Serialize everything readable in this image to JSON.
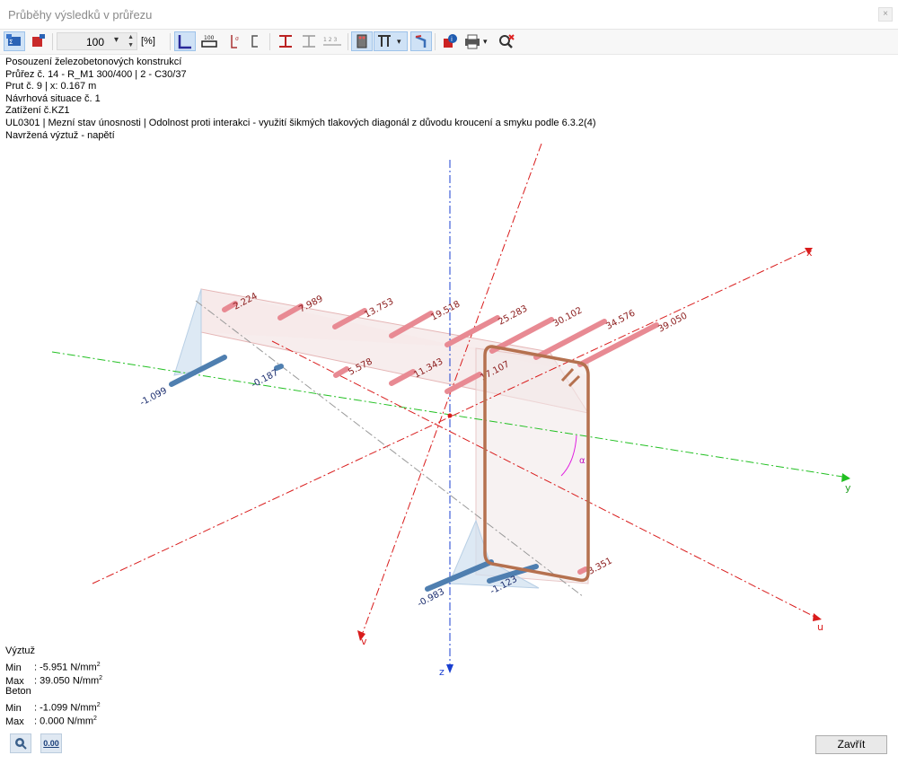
{
  "window": {
    "title": "Průběhy výsledků v průřezu",
    "close_glyph": "×"
  },
  "toolbar": {
    "zoom_value": "100",
    "zoom_unit": "[%]",
    "icons": [
      "section-values-icon",
      "section-values-alt-icon",
      "result-diagram-icon",
      "dimension-icon",
      "stress-icon",
      "section-outline-icon",
      "beam-section-icon",
      "beam-section-outline-icon",
      "numbering-icon",
      "rebar-icon",
      "rebar-dropdown-icon",
      "view-3d-icon",
      "info-icon",
      "print-icon",
      "zoom-reset-icon"
    ]
  },
  "info": {
    "lines": [
      "Posouzení železobetonových konstrukcí",
      "Průřez č. 14 - R_M1 300/400 | 2 - C30/37",
      "Prut č. 9 | x: 0.167 m",
      "Návrhová situace č. 1",
      "Zatížení č.KZ1",
      "UL0301 | Mezní stav únosnosti | Odolnost proti interakci - využití šikmých tlakových diagonál z důvodu kroucení a smyku podle 6.3.2(4)",
      "Navržená výztuž - napětí"
    ]
  },
  "diagram": {
    "axes": {
      "x": "x",
      "y": "y",
      "z": "z",
      "u": "u",
      "v": "v"
    },
    "angle_label": "α",
    "colors": {
      "tension": "#e0737c",
      "compression": "#4f7fb0",
      "stirrup": "#b5714f",
      "axis_red": "#d91c1c",
      "axis_green": "#22c022",
      "axis_blue": "#1a3fd0"
    },
    "tension_bars": [
      "2.224",
      "7.989",
      "13.753",
      "19.518",
      "25.283",
      "30.102",
      "34.576",
      "39.050",
      "5.578",
      "11.343",
      "17.107",
      "3.351"
    ],
    "compression_bars": [
      "-1.099",
      "-0.187",
      "-0.983",
      "-1.123"
    ]
  },
  "summary": {
    "rebar_heading": "Výztuž",
    "rebar_min_label": "Min",
    "rebar_min": ": -5.951 N/mm",
    "rebar_max_label": "Max",
    "rebar_max": ": 39.050 N/mm",
    "concrete_heading": "Beton",
    "concrete_min_label": "Min",
    "concrete_min": ": -1.099 N/mm",
    "concrete_max_label": "Max",
    "concrete_max": ":  0.000 N/mm",
    "exp": "2"
  },
  "footer": {
    "close_label": "Zavřít",
    "values_icon_text": "0.00"
  }
}
